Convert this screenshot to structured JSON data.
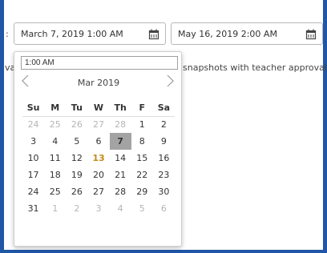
{
  "frame": {
    "border_color": "#1f56a6"
  },
  "label_fragment": ":",
  "left_fragment": "va",
  "start_field": {
    "value": "March 7, 2019 1:00 AM",
    "icon": "calendar-icon"
  },
  "end_field": {
    "value": "May 16, 2019 2:00 AM",
    "icon": "calendar-icon"
  },
  "option_text_fragment": "snapshots with teacher approval",
  "datepicker": {
    "time_value": "1:00 AM",
    "month_label": "Mar 2019",
    "prev_icon": "chevron-left-icon",
    "next_icon": "chevron-right-icon",
    "weekdays": [
      "Su",
      "M",
      "Tu",
      "W",
      "Th",
      "F",
      "Sa"
    ],
    "weeks": [
      [
        "24",
        "25",
        "26",
        "27",
        "28",
        "1",
        "2"
      ],
      [
        "3",
        "4",
        "5",
        "6",
        "7",
        "8",
        "9"
      ],
      [
        "10",
        "11",
        "12",
        "13",
        "14",
        "15",
        "16"
      ],
      [
        "17",
        "18",
        "19",
        "20",
        "21",
        "22",
        "23"
      ],
      [
        "24",
        "25",
        "26",
        "27",
        "28",
        "29",
        "30"
      ],
      [
        "31",
        "1",
        "2",
        "3",
        "4",
        "5",
        "6"
      ]
    ],
    "selected_day": "7",
    "today_day": "13",
    "colors": {
      "selected_bg": "#a3a3a3",
      "today_text": "#c48a19",
      "other_month_text": "#b5b5b5"
    }
  }
}
